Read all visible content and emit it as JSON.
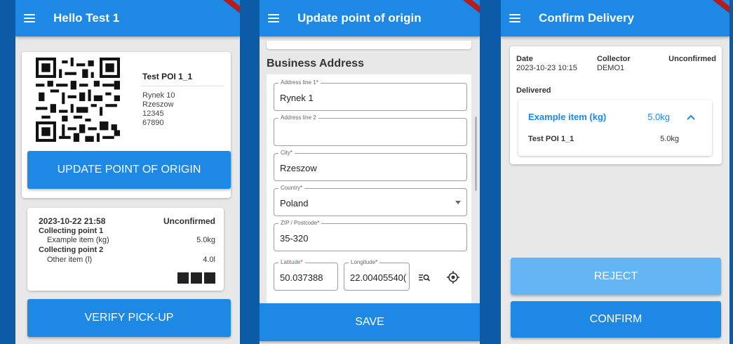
{
  "screen1": {
    "title": "Hello Test 1",
    "poi": {
      "name": "Test POI 1_1",
      "address_line": "Rynek 10",
      "city": "Rzeszow",
      "number1": "12345",
      "number2": "67890"
    },
    "update_button": "UPDATE POINT OF ORIGIN",
    "collection": {
      "datetime": "2023-10-22 21:58",
      "status": "Unconfirmed",
      "points": [
        {
          "name": "Collecting point 1",
          "item": "Example item (kg)",
          "qty": "5.0kg"
        },
        {
          "name": "Collecting point 2",
          "item": "Other item (l)",
          "qty": "4.0l"
        }
      ]
    },
    "verify_button": "VERIFY PICK-UP"
  },
  "screen2": {
    "title": "Update point of origin",
    "section_title": "Business Address",
    "fields": {
      "address1": {
        "label": "Address line 1",
        "value": "Rynek 1"
      },
      "address2": {
        "label": "Address line 2",
        "value": ""
      },
      "city": {
        "label": "City",
        "value": "Rzeszow"
      },
      "country": {
        "label": "Country",
        "value": "Poland"
      },
      "zip": {
        "label": "ZIP / Postcode",
        "value": "35-320"
      },
      "latitude": {
        "label": "Latitude",
        "value": "50.037388"
      },
      "longitude": {
        "label": "Longitude",
        "value": "22.00405540("
      }
    },
    "required_mark": "*",
    "save_button": "SAVE"
  },
  "screen3": {
    "title": "Confirm Delivery",
    "date_label": "Date",
    "date_value": "2023-10-23 10:15",
    "collector_label": "Collector",
    "collector_value": "DEMO1",
    "status": "Unconfirmed",
    "delivered_label": "Delivered",
    "item_name": "Example item (kg)",
    "item_qty": "5.0kg",
    "poi_name": "Test POI 1_1",
    "poi_qty": "5.0kg",
    "reject_button": "REJECT",
    "confirm_button": "CONFIRM"
  },
  "colors": {
    "primary": "#1e88e5",
    "disabled": "#64b5f6",
    "background": "#0d5aa7",
    "required": "#d32f2f"
  },
  "icons": [
    "menu-icon",
    "qr-code",
    "chevron-up-icon",
    "dropdown-arrow-icon",
    "map-search-icon",
    "gps-locate-icon"
  ]
}
